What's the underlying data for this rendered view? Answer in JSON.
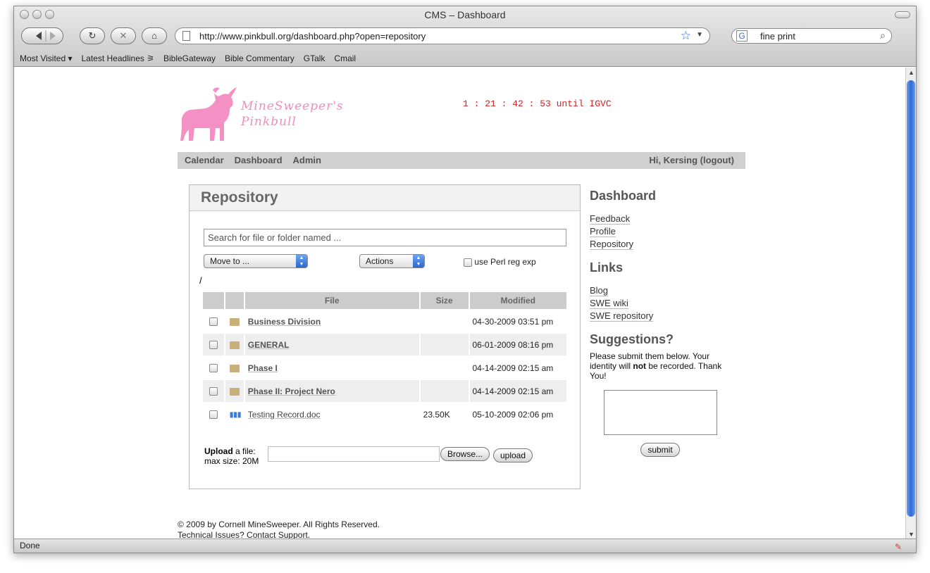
{
  "window": {
    "title": "CMS – Dashboard"
  },
  "toolbar": {
    "url": "http://www.pinkbull.org/dashboard.php?open=repository",
    "search_value": "fine print",
    "search_engine_glyph": "G"
  },
  "bookmarks": [
    "Most Visited ▾",
    "Latest Headlines ⚞",
    "BibleGateway",
    "Bible Commentary",
    "GTalk",
    "Cmail"
  ],
  "status": {
    "text": "Done"
  },
  "site": {
    "brand_line1": "MineSweeper's",
    "brand_line2": "Pinkbull",
    "countdown": "1 : 21 : 42 : 53 until IGVC",
    "logo_color": "#f590c5"
  },
  "nav": {
    "items": [
      "Calendar",
      "Dashboard",
      "Admin"
    ],
    "greeting": "Hi, Kersing (logout)"
  },
  "repository": {
    "title": "Repository",
    "search_placeholder": "Search for file or folder named ...",
    "move_to": "Move to ...",
    "actions": "Actions",
    "perl_label": "use Perl reg exp",
    "path": "/",
    "columns": {
      "file": "File",
      "size": "Size",
      "modified": "Modified"
    },
    "rows": [
      {
        "type": "folder",
        "name": "Business Division",
        "size": "",
        "modified": "04-30-2009 03:51 pm"
      },
      {
        "type": "folder",
        "name": "GENERAL",
        "size": "",
        "modified": "06-01-2009 08:16 pm"
      },
      {
        "type": "folder",
        "name": "Phase I",
        "size": "",
        "modified": "04-14-2009 02:15 am"
      },
      {
        "type": "folder",
        "name": "Phase II: Project Nero",
        "size": "",
        "modified": "04-14-2009 02:15 am"
      },
      {
        "type": "doc",
        "name": "Testing Record.doc",
        "size": "23.50K",
        "modified": "05-10-2009 02:06 pm"
      }
    ],
    "upload_bold": "Upload",
    "upload_rest": " a file:",
    "upload_max": "max size: 20M",
    "browse": "Browse...",
    "upload_btn": "upload"
  },
  "sidebar": {
    "dashboard_title": "Dashboard",
    "dashboard_links": [
      "Feedback",
      "Profile",
      "Repository"
    ],
    "links_title": "Links",
    "links": [
      "Blog",
      "SWE wiki",
      "SWE repository"
    ],
    "suggest_title": "Suggestions?",
    "suggest_text_1": "Please submit them below. Your identity will ",
    "suggest_bold": "not",
    "suggest_text_2": " be recorded. Thank You!",
    "submit": "submit"
  },
  "footer": {
    "line1": "© 2009 by Cornell MineSweeper. All Rights Reserved.",
    "line2_pre": "Technical Issues? Contact ",
    "line2_link": "Support",
    "line2_post": "."
  }
}
